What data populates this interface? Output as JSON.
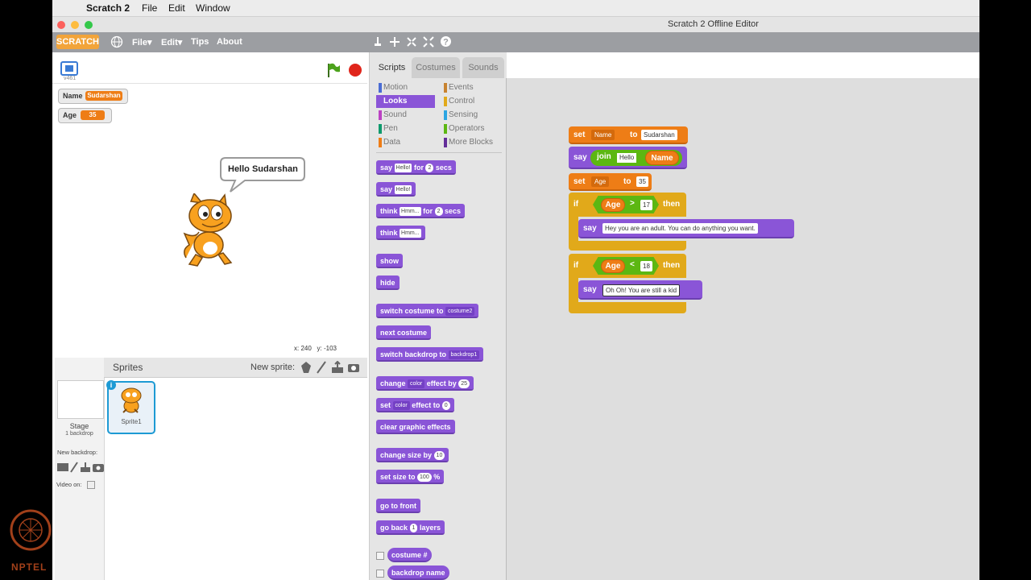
{
  "mac_menu": {
    "app": "Scratch 2",
    "file": "File",
    "edit": "Edit",
    "window": "Window"
  },
  "window_title": "Scratch 2 Offline Editor",
  "scratch_menu": {
    "logo": "SCRATCH",
    "file": "File▾",
    "edit": "Edit▾",
    "tips": "Tips",
    "about": "About"
  },
  "stage": {
    "version": "v461",
    "monitors": [
      {
        "label": "Name",
        "value": "Sudarshan"
      },
      {
        "label": "Age",
        "value": "35"
      }
    ],
    "speech": "Hello Sudarshan",
    "coords": {
      "x_label": "x:",
      "x": "240",
      "y_label": "y:",
      "y": "-103"
    }
  },
  "sprites_pane": {
    "title": "Sprites",
    "new_sprite": "New sprite:",
    "stage_label": "Stage",
    "stage_sub": "1 backdrop",
    "new_backdrop": "New backdrop:",
    "video_on": "Video on:",
    "sprite_name": "Sprite1"
  },
  "tabs": [
    "Scripts",
    "Costumes",
    "Sounds"
  ],
  "categories": {
    "left": [
      {
        "label": "Motion",
        "color": "#4a6cd4"
      },
      {
        "label": "Looks",
        "color": "#8a55d7"
      },
      {
        "label": "Sound",
        "color": "#bb42c3"
      },
      {
        "label": "Pen",
        "color": "#0e9a6c"
      },
      {
        "label": "Data",
        "color": "#ee7d16"
      }
    ],
    "right": [
      {
        "label": "Events",
        "color": "#c88330"
      },
      {
        "label": "Control",
        "color": "#e1a91a"
      },
      {
        "label": "Sensing",
        "color": "#2ca5e2"
      },
      {
        "label": "Operators",
        "color": "#5cb712"
      },
      {
        "label": "More Blocks",
        "color": "#632d99"
      }
    ]
  },
  "palette": {
    "say_for": {
      "a": "say",
      "b": "Hello!",
      "c": "for",
      "d": "2",
      "e": "secs"
    },
    "say": {
      "a": "say",
      "b": "Hello!"
    },
    "think_for": {
      "a": "think",
      "b": "Hmm...",
      "c": "for",
      "d": "2",
      "e": "secs"
    },
    "think": {
      "a": "think",
      "b": "Hmm..."
    },
    "show": "show",
    "hide": "hide",
    "switch_costume": {
      "a": "switch costume to",
      "b": "costume2"
    },
    "next_costume": "next costume",
    "switch_backdrop": {
      "a": "switch backdrop to",
      "b": "backdrop1"
    },
    "change_effect": {
      "a": "change",
      "b": "color",
      "c": "effect by",
      "d": "25"
    },
    "set_effect": {
      "a": "set",
      "b": "color",
      "c": "effect to",
      "d": "0"
    },
    "clear_effects": "clear graphic effects",
    "change_size": {
      "a": "change size by",
      "b": "10"
    },
    "set_size": {
      "a": "set size to",
      "b": "100",
      "c": "%"
    },
    "go_front": "go to front",
    "go_back": {
      "a": "go back",
      "b": "1",
      "c": "layers"
    },
    "costume_num": "costume #",
    "backdrop_name": "backdrop name"
  },
  "script": {
    "set1": {
      "a": "set",
      "var": "Name",
      "to": "to",
      "value": "Sudarshan"
    },
    "say1": {
      "a": "say",
      "join": "join",
      "hello": "Hello",
      "var": "Name"
    },
    "set2": {
      "a": "set",
      "var": "Age",
      "to": "to",
      "value": "35"
    },
    "if1": {
      "if": "if",
      "var": "Age",
      "op": ">",
      "num": "17",
      "then": "then",
      "say": "say",
      "msg": "Hey you are an adult. You can do anything you want."
    },
    "if2": {
      "if": "if",
      "var": "Age",
      "op": "<",
      "num": "18",
      "then": "then",
      "say": "say",
      "msg": "Oh Oh! You are still a kid"
    }
  },
  "watermark": "NPTEL"
}
